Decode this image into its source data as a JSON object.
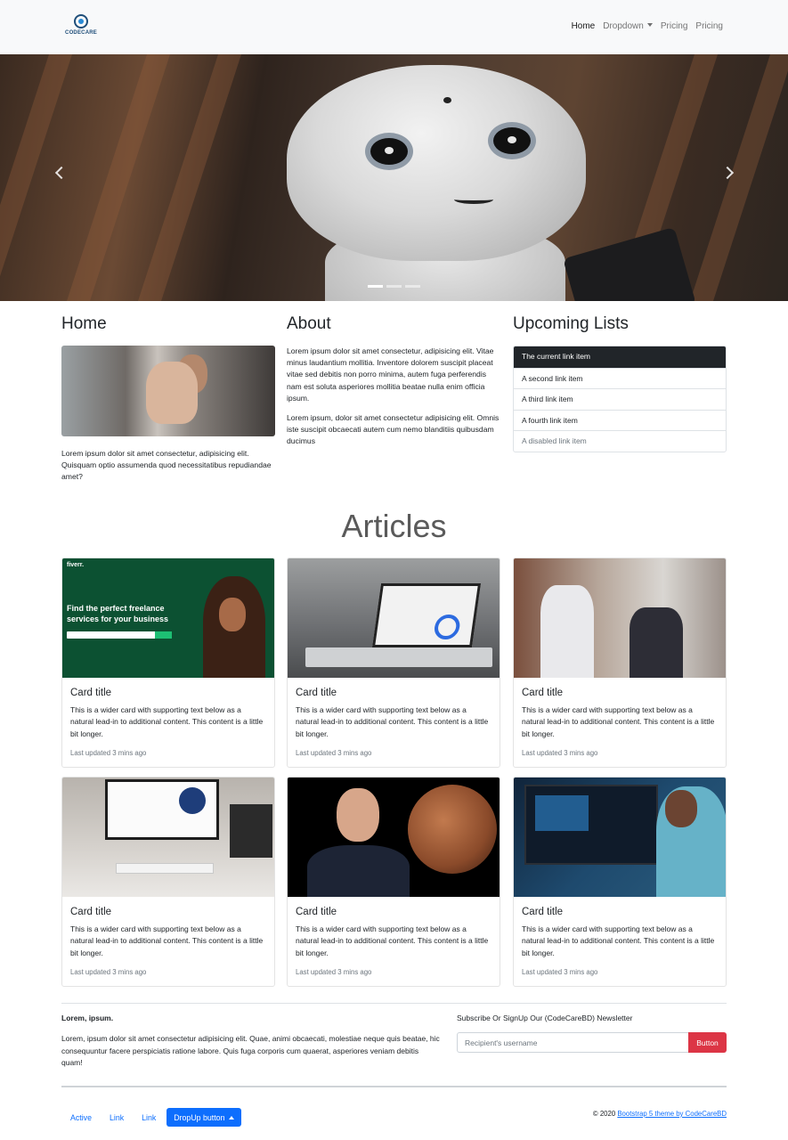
{
  "brand": {
    "name": "CODECARE"
  },
  "nav": {
    "home": "Home",
    "dropdown": "Dropdown",
    "pricing1": "Pricing",
    "pricing2": "Pricing"
  },
  "hero": {
    "slide_count": 3,
    "active_slide": 1
  },
  "home": {
    "heading": "Home",
    "text": "Lorem ipsum dolor sit amet consectetur, adipisicing elit. Quisquam optio assumenda quod necessitatibus repudiandae amet?"
  },
  "about": {
    "heading": "About",
    "p1": "Lorem ipsum dolor sit amet consectetur, adipisicing elit. Vitae minus laudantium mollitia. Inventore dolorem suscipit placeat vitae sed debitis non porro minima, autem fuga perferendis nam est soluta asperiores mollitia beatae nulla enim officia ipsum.",
    "p2": "Lorem ipsum, dolor sit amet consectetur adipisicing elit. Omnis iste suscipit obcaecati autem cum nemo blanditiis quibusdam ducimus"
  },
  "upcoming": {
    "heading": "Upcoming Lists",
    "items": [
      "The current link item",
      "A second link item",
      "A third link item",
      "A fourth link item",
      "A disabled link item"
    ]
  },
  "articles": {
    "heading": "Articles",
    "cards": [
      {
        "title": "Card title",
        "text": "This is a wider card with supporting text below as a natural lead-in to additional content. This content is a little bit longer.",
        "updated": "Last updated 3 mins ago",
        "thumb": {
          "logo": "fiverr.",
          "headline": "Find the perfect freelance services for your business"
        }
      },
      {
        "title": "Card title",
        "text": "This is a wider card with supporting text below as a natural lead-in to additional content. This content is a little bit longer.",
        "updated": "Last updated 3 mins ago"
      },
      {
        "title": "Card title",
        "text": "This is a wider card with supporting text below as a natural lead-in to additional content. This content is a little bit longer.",
        "updated": "Last updated 3 mins ago"
      },
      {
        "title": "Card title",
        "text": "This is a wider card with supporting text below as a natural lead-in to additional content. This content is a little bit longer.",
        "updated": "Last updated 3 mins ago"
      },
      {
        "title": "Card title",
        "text": "This is a wider card with supporting text below as a natural lead-in to additional content. This content is a little bit longer.",
        "updated": "Last updated 3 mins ago"
      },
      {
        "title": "Card title",
        "text": "This is a wider card with supporting text below as a natural lead-in to additional content. This content is a little bit longer.",
        "updated": "Last updated 3 mins ago"
      }
    ]
  },
  "footer": {
    "heading": "Lorem, ipsum.",
    "text": "Lorem, ipsum dolor sit amet consectetur adipisicing elit. Quae, animi obcaecati, molestiae neque quis beatae, hic consequuntur facere perspiciatis ratione labore. Quis fuga corporis cum quaerat, asperiores veniam debitis quam!",
    "newsletter_label": "Subscribe Or SignUp Our (CodeCareBD) Newsletter",
    "newsletter_placeholder": "Recipient's username",
    "newsletter_button": "Button",
    "links": [
      "Active",
      "Link",
      "Link"
    ],
    "dropup": "DropUp button",
    "copyright_prefix": "© 2020 ",
    "copyright_link": "Bootstrap 5 theme by CodeCareBD"
  },
  "colors": {
    "primary": "#0d6efd",
    "danger": "#dc3545",
    "dark": "#212529",
    "navbar_bg": "#f8f9fa"
  }
}
